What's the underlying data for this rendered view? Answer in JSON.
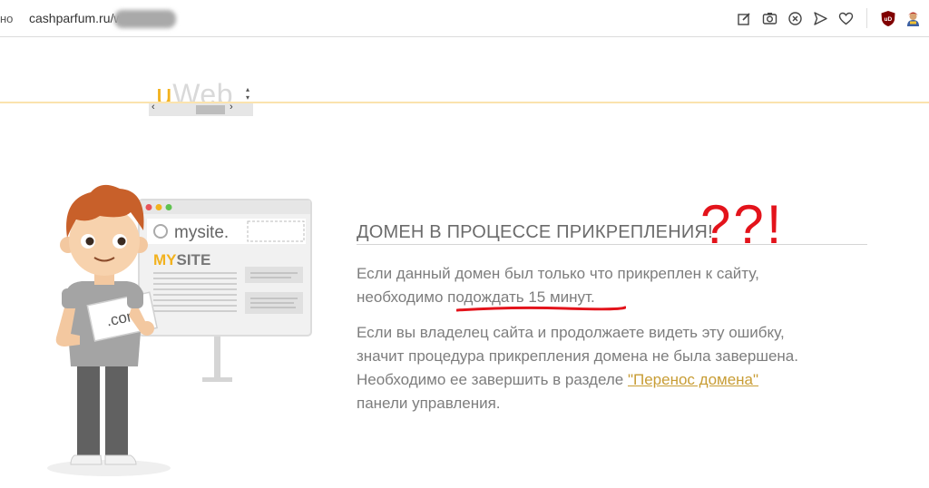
{
  "browser": {
    "address_prefix": "но",
    "url_visible": "cashparfum.ru/w",
    "toolbar_icons": [
      "edit-icon",
      "camera-icon",
      "close-circle-icon",
      "send-icon",
      "heart-icon",
      "ublock-icon",
      "extension-avatar-icon"
    ]
  },
  "header": {
    "logo_u": "u",
    "logo_rest": "Web",
    "scroll_left": "‹",
    "scroll_right": "›"
  },
  "illustration": {
    "site_url": "mysite.",
    "site_name_highlight": "MY",
    "site_name_rest": "SITE",
    "sign_text": ".com"
  },
  "message": {
    "title": "ДОМЕН В ПРОЦЕССЕ ПРИКРЕПЛЕНИЯ!",
    "annotation": "??!",
    "p1_line1": "Если данный домен был только что прикреплен к сайту,",
    "p1_line2_prefix": "необходимо ",
    "p1_line2_highlight": "подождать 15 минут",
    "p1_line2_suffix": ".",
    "p2_line1": "Если вы владелец сайта и продолжаете видеть эту ошибку,",
    "p2_line2": "значит процедура прикрепления домена не была завершена.",
    "p2_line3_prefix": "Необходимо ее завершить в разделе ",
    "p2_link": "\"Перенос домена\"",
    "p2_line4": "панели управления."
  },
  "colors": {
    "accent": "#f2b21e",
    "annotation_red": "#e3131b",
    "link": "#c89d35",
    "text": "#7d7d7d"
  }
}
